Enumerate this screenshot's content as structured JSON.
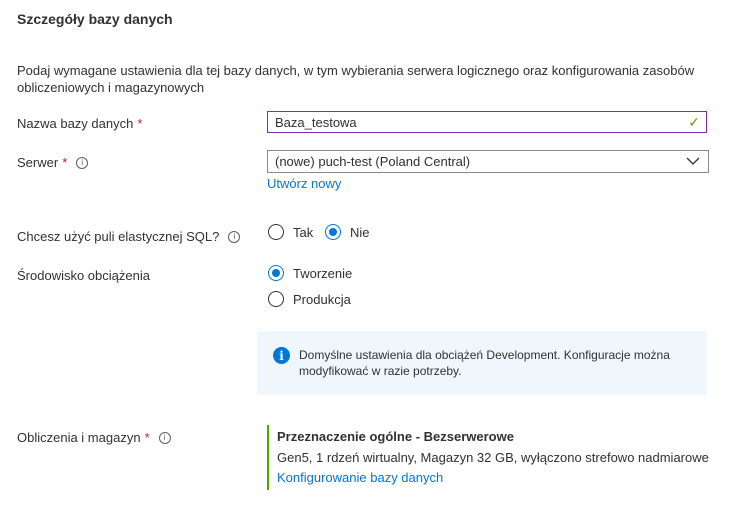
{
  "section": {
    "title": "Szczegóły bazy danych",
    "description": "Podaj wymagane ustawienia dla tej bazy danych, w tym wybierania serwera logicznego oraz konfigurowania zasobów obliczeniowych i magazynowych"
  },
  "fields": {
    "db_name": {
      "label": "Nazwa bazy danych",
      "required_mark": "*",
      "value": "Baza_testowa"
    },
    "server": {
      "label": "Serwer",
      "required_mark": "*",
      "value": "(nowe) puch-test (Poland Central)",
      "create_link": "Utwórz nowy"
    },
    "elastic_pool": {
      "label": "Chcesz użyć puli elastycznej SQL?",
      "options": [
        "Tak",
        "Nie"
      ],
      "selected": "Nie"
    },
    "workload": {
      "label": "Środowisko obciążenia",
      "options": [
        "Tworzenie",
        "Produkcja"
      ],
      "selected": "Tworzenie"
    },
    "compute": {
      "label": "Obliczenia i magazyn",
      "required_mark": "*",
      "tier": "Przeznaczenie ogólne - Bezserwerowe",
      "details": "Gen5, 1 rdzeń wirtualny, Magazyn 32 GB, wyłączono strefowo nadmiarowe",
      "configure_link": "Konfigurowanie bazy danych"
    }
  },
  "info_box": {
    "text": "Domyślne ustawienia dla obciążeń Development. Konfiguracje można modyfikować w razie potrzeby."
  },
  "icons": {
    "info": "info-icon",
    "check": "check-icon",
    "chevron": "chevron-down-icon"
  },
  "colors": {
    "accent": "#0078d4",
    "required": "#a4262c",
    "valid": "#57a300",
    "focus_border": "#8a2da5",
    "info_bg": "#eff6fc"
  }
}
